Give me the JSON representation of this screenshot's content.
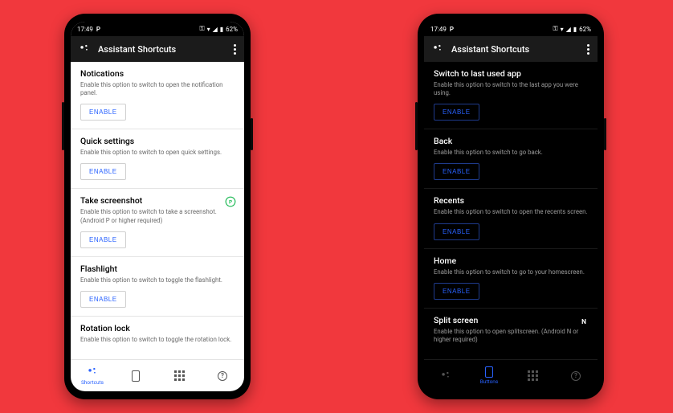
{
  "statusbar": {
    "time": "17:49",
    "indicator": "P",
    "battery": "62%"
  },
  "appbar": {
    "title": "Assistant Shortcuts"
  },
  "buttons": {
    "enable": "ENABLE"
  },
  "nav": {
    "shortcuts": "Shortcuts",
    "buttons": "Buttons"
  },
  "left": {
    "items": [
      {
        "title": "Notications",
        "desc": "Enable this option to switch to open the notification panel."
      },
      {
        "title": "Quick settings",
        "desc": "Enable this option to switch to open quick settings."
      },
      {
        "title": "Take screenshot",
        "desc": "Enable this option to switch to take a screenshot. (Android P or higher required)",
        "badge": "P"
      },
      {
        "title": "Flashlight",
        "desc": "Enable this option to switch to toggle the flashlight."
      },
      {
        "title": "Rotation lock",
        "desc": "Enable this option to switch to toggle the rotation lock."
      }
    ]
  },
  "right": {
    "items": [
      {
        "title": "Switch to last used app",
        "desc": "Enable this option to switch to the last app you were using."
      },
      {
        "title": "Back",
        "desc": "Enable this option to switch to go back."
      },
      {
        "title": "Recents",
        "desc": "Enable this option to switch to open the recents screen."
      },
      {
        "title": "Home",
        "desc": "Enable this option to switch to go to your homescreen."
      },
      {
        "title": "Split screen",
        "desc": "Enable this option to open splitscreen. (Android N or higher required)",
        "badge": "N"
      }
    ]
  },
  "colors": {
    "accent": "#2962ff",
    "background": "#f1383d"
  }
}
